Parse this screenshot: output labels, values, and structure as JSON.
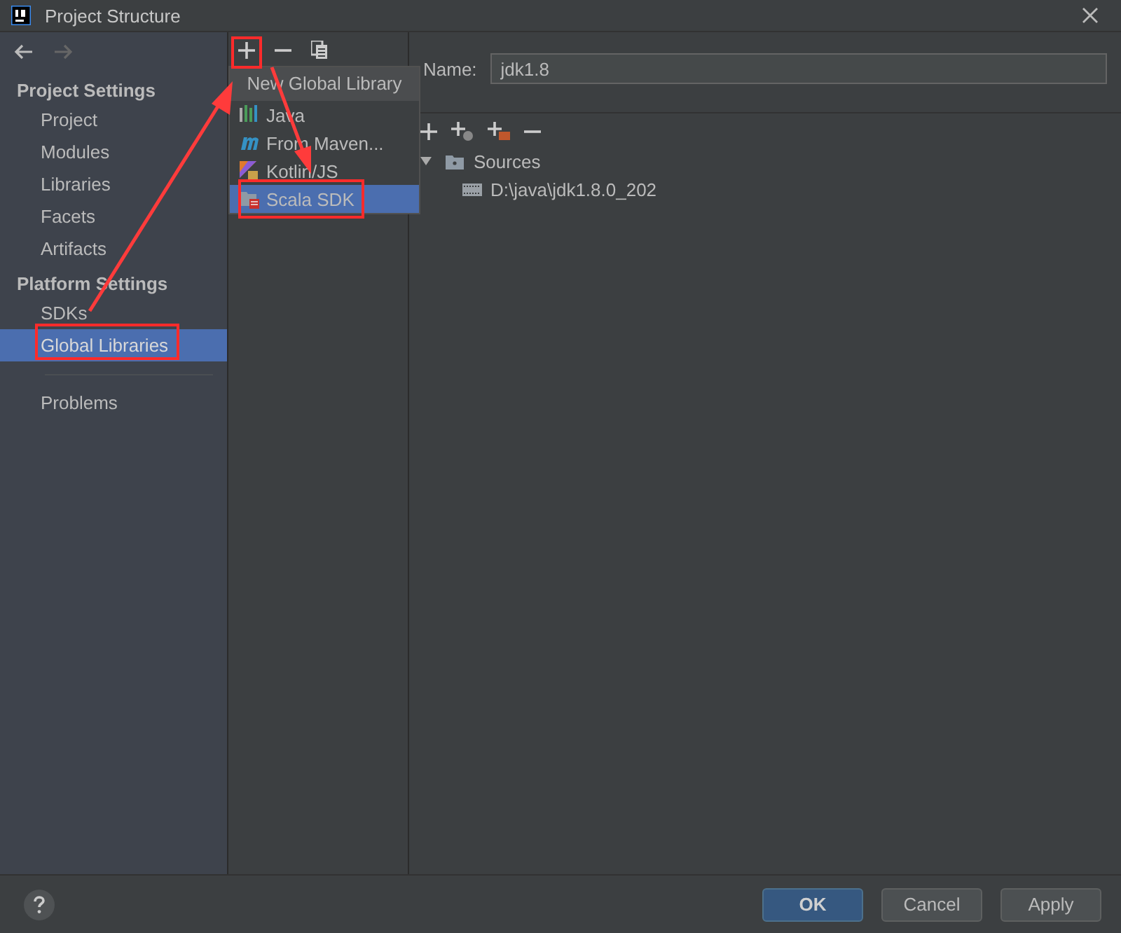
{
  "window": {
    "title": "Project Structure"
  },
  "sidebar": {
    "sections": [
      {
        "heading": "Project Settings",
        "items": [
          {
            "label": "Project",
            "selected": false
          },
          {
            "label": "Modules",
            "selected": false
          },
          {
            "label": "Libraries",
            "selected": false
          },
          {
            "label": "Facets",
            "selected": false
          },
          {
            "label": "Artifacts",
            "selected": false
          }
        ]
      },
      {
        "heading": "Platform Settings",
        "items": [
          {
            "label": "SDKs",
            "selected": false
          },
          {
            "label": "Global Libraries",
            "selected": true
          }
        ]
      }
    ],
    "extra_items": [
      {
        "label": "Problems",
        "selected": false
      }
    ]
  },
  "popup": {
    "title": "New Global Library",
    "items": [
      {
        "label": "Java",
        "kind": "java",
        "selected": false
      },
      {
        "label": "From Maven...",
        "kind": "maven",
        "selected": false
      },
      {
        "label": "Kotlin/JS",
        "kind": "kotlin",
        "selected": false
      },
      {
        "label": "Scala SDK",
        "kind": "scala",
        "selected": true
      }
    ]
  },
  "detail": {
    "name_label": "Name:",
    "name_value": "jdk1.8",
    "tree": [
      {
        "label": "Sources",
        "kind": "folder",
        "expanded": true,
        "children": [
          {
            "label": "D:\\java\\jdk1.8.0_202",
            "kind": "jar"
          }
        ]
      }
    ]
  },
  "buttons": [
    {
      "label": "OK",
      "kind": "primary"
    },
    {
      "label": "Cancel",
      "kind": "normal"
    },
    {
      "label": "Apply",
      "kind": "normal"
    }
  ]
}
